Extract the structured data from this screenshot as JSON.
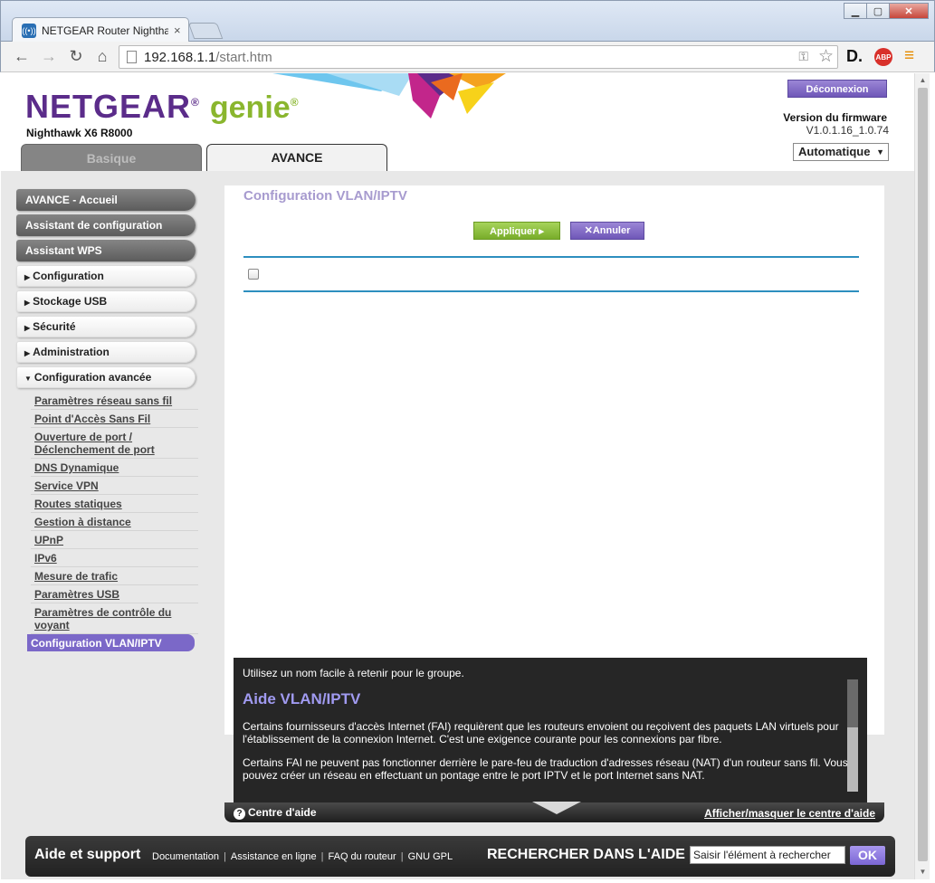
{
  "browser": {
    "tab_title": "NETGEAR Router Nightha",
    "tab_close": "×",
    "url_host": "192.168.1.1",
    "url_path": "/start.htm",
    "window_controls": {
      "minimize": "▁",
      "maximize": "▢",
      "close": "✕"
    }
  },
  "header": {
    "logo_brand": "NETGEAR",
    "logo_genie": "genie",
    "model": "Nighthawk X6 R8000",
    "tabs": {
      "basic": "Basique",
      "advanced": "AVANCE"
    },
    "logout": "Déconnexion",
    "firmware_label": "Version du firmware",
    "firmware_version": "V1.0.1.16_1.0.74",
    "language": "Automatique"
  },
  "sidebar": {
    "main": [
      {
        "label": "AVANCE - Accueil"
      },
      {
        "label": "Assistant de configuration"
      },
      {
        "label": "Assistant WPS"
      }
    ],
    "sections": [
      {
        "label": "Configuration"
      },
      {
        "label": "Stockage USB"
      },
      {
        "label": "Sécurité"
      },
      {
        "label": "Administration"
      },
      {
        "label": "Configuration avancée"
      }
    ],
    "sub_items": [
      {
        "label": "Paramètres réseau sans fil"
      },
      {
        "label": "Point d'Accès Sans Fil"
      },
      {
        "label": "Ouverture de port / Déclenchement de port"
      },
      {
        "label": "DNS Dynamique"
      },
      {
        "label": "Service VPN"
      },
      {
        "label": "Routes statiques"
      },
      {
        "label": "Gestion à distance"
      },
      {
        "label": "UPnP"
      },
      {
        "label": "IPv6"
      },
      {
        "label": "Mesure de trafic"
      },
      {
        "label": "Paramètres USB"
      },
      {
        "label": "Paramètres de contrôle du voyant"
      },
      {
        "label": "Configuration VLAN/IPTV"
      }
    ]
  },
  "main": {
    "title": "Configuration VLAN/IPTV",
    "apply": "Appliquer ▸",
    "cancel": "Annuler",
    "checkbox_checked": false
  },
  "help": {
    "intro": "Utilisez un nom facile à retenir pour le groupe.",
    "title": "Aide VLAN/IPTV",
    "p1": "Certains fournisseurs d'accès Internet (FAI) requièrent que les routeurs envoient ou reçoivent des paquets LAN virtuels pour l'établissement de la connexion Internet. C'est une exigence courante pour les connexions par fibre.",
    "p2": "Certains FAI ne peuvent pas fonctionner derrière le pare-feu de traduction d'adresses réseau (NAT) d'un routeur sans fil. Vous pouvez créer un réseau en effectuant un pontage entre le port IPTV et le port Internet sans NAT.",
    "center": "Centre d'aide",
    "toggle": "Afficher/masquer le centre d'aide"
  },
  "footer": {
    "title": "Aide et support",
    "links": [
      "Documentation",
      "Assistance en ligne",
      "FAQ du routeur",
      "GNU GPL"
    ],
    "search_label": "RECHERCHER DANS L'AIDE",
    "search_value": "Saisir l'élément à rechercher",
    "ok": "OK"
  },
  "colors": {
    "brand_purple": "#5b2c8a",
    "genie_green": "#8ab62e",
    "accent_violet": "#7b68c8",
    "rule_blue": "#2d8fbf"
  }
}
